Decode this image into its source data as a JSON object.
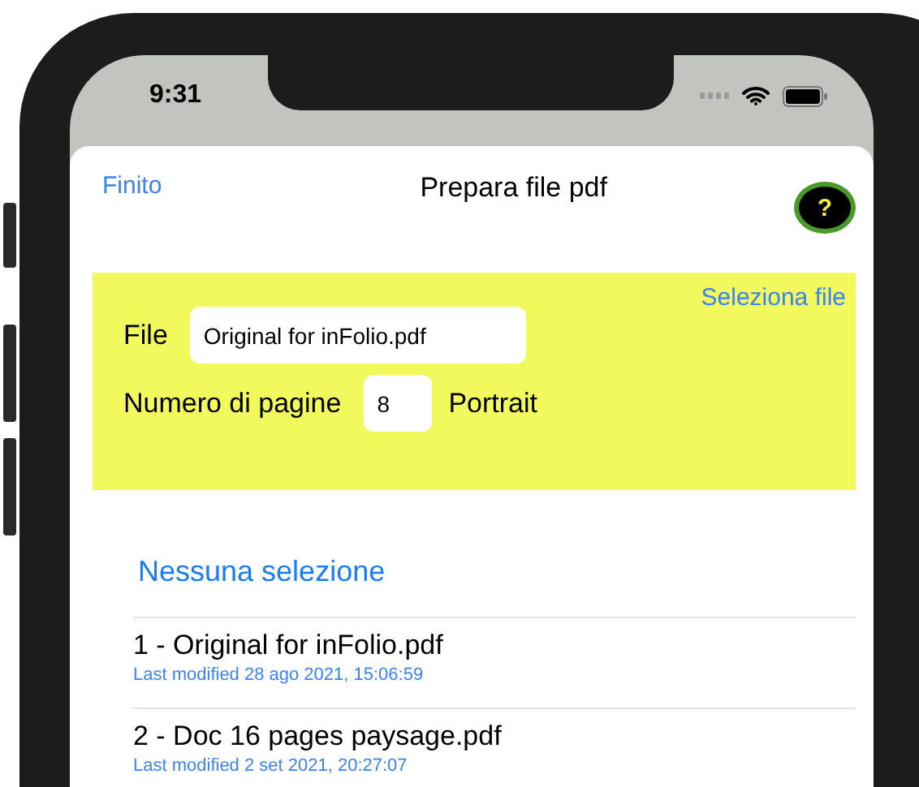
{
  "status_bar": {
    "time": "9:31"
  },
  "nav": {
    "done": "Finito",
    "title": "Prepara file pdf",
    "help": "?"
  },
  "file_panel": {
    "select_link": "Seleziona file",
    "file_label": "File",
    "file_value": "Original for inFolio.pdf",
    "pages_label": "Numero di pagine",
    "pages_value": "8",
    "orientation": "Portrait"
  },
  "list": {
    "header": "Nessuna selezione",
    "items": [
      {
        "title": "1 - Original for inFolio.pdf",
        "subtitle": "Last modified 28 ago 2021, 15:06:59",
        "selected": false
      },
      {
        "title": "2 - Doc 16 pages paysage.pdf",
        "subtitle": "Last modified 2 set 2021, 20:27:07",
        "selected": false
      }
    ]
  }
}
